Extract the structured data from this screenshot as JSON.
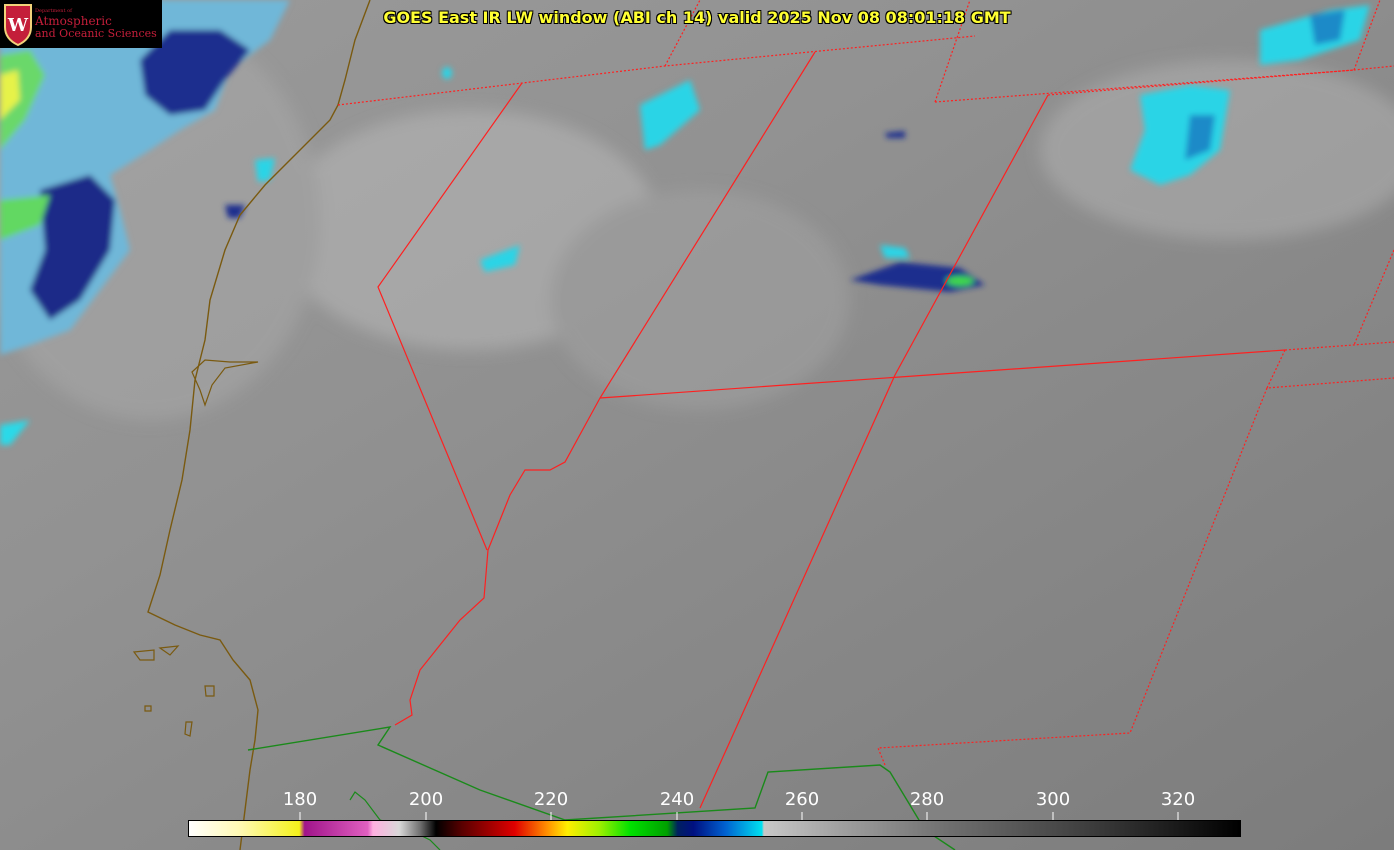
{
  "title": "GOES East IR LW window (ABI ch 14) valid 2025 Nov 08 08:01:18 GMT",
  "logo": {
    "department": "Department of",
    "line1": "Atmospheric",
    "line2": "and Oceanic Sciences",
    "seal_letter": "W"
  },
  "colorbar": {
    "ticks": [
      "180",
      "200",
      "220",
      "240",
      "260",
      "280",
      "300",
      "320"
    ],
    "range_min": 163,
    "range_max": 331
  },
  "colors": {
    "title": "#ffff33",
    "state_borders": "#ff2020",
    "coastline": "#7a5a10",
    "country_border": "#1a8a1a",
    "logo_text": "#c41e3a"
  }
}
